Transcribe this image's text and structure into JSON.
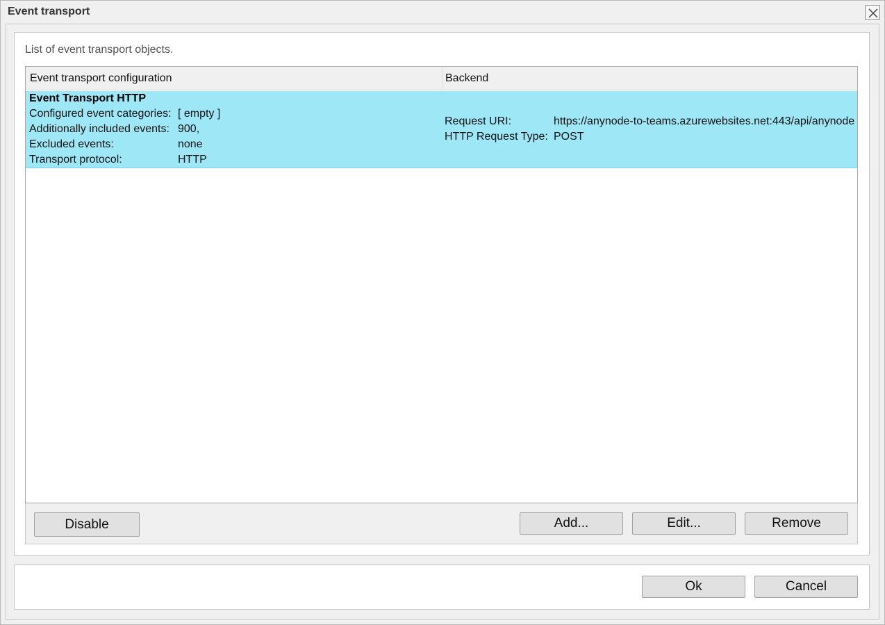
{
  "window": {
    "title": "Event transport",
    "close_icon": "close-icon"
  },
  "description": "List of event transport objects.",
  "table": {
    "columns": [
      "Event transport configuration",
      "Backend"
    ],
    "rows": [
      {
        "title": "Event Transport HTTP",
        "config": [
          {
            "label": "Configured event categories:",
            "value": "[ empty ]"
          },
          {
            "label": "Additionally included events:",
            "value": "900,"
          },
          {
            "label": "Excluded events:",
            "value": "none"
          },
          {
            "label": "Transport protocol:",
            "value": "HTTP"
          }
        ],
        "backend": [
          {
            "label": "Request URI:",
            "value": "https://anynode-to-teams.azurewebsites.net:443/api/anynode"
          },
          {
            "label": "HTTP Request Type:",
            "value": "POST"
          }
        ],
        "selected": true,
        "selected_color": "#9ee7f6"
      }
    ]
  },
  "actions": {
    "disable": "Disable",
    "add": "Add...",
    "edit": "Edit...",
    "remove": "Remove"
  },
  "footer": {
    "ok": "Ok",
    "cancel": "Cancel"
  }
}
